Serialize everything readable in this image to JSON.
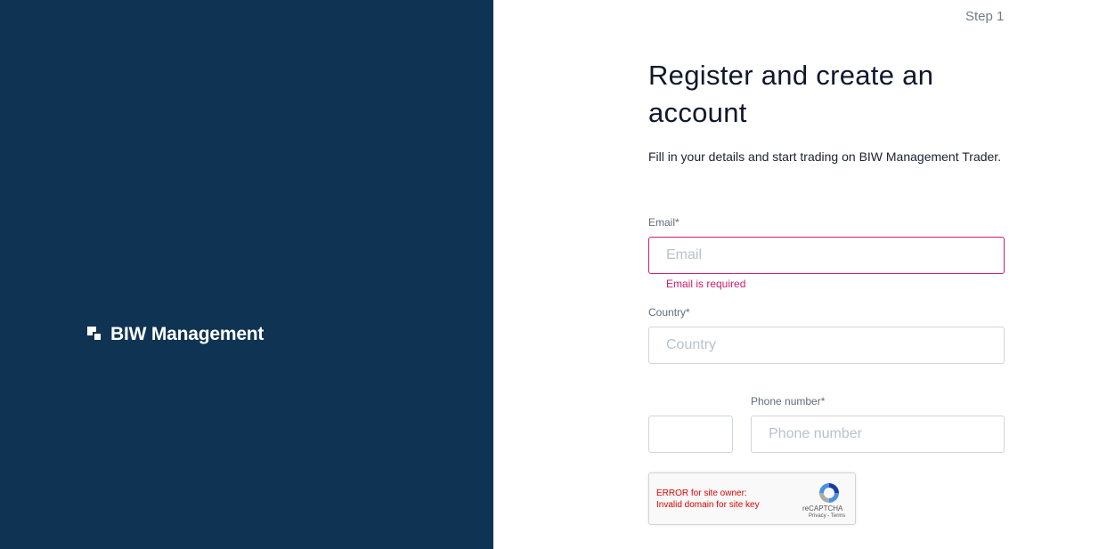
{
  "brand": {
    "name": "BIW Management"
  },
  "header": {
    "step": "Step 1"
  },
  "form": {
    "title": "Register and create an account",
    "subtitle": "Fill in your details and start trading on BIW Management Trader.",
    "email": {
      "label": "Email*",
      "placeholder": "Email",
      "value": "",
      "error": "Email is required"
    },
    "country": {
      "label": "Country*",
      "placeholder": "Country",
      "value": ""
    },
    "phone_code": {
      "value": ""
    },
    "phone": {
      "label": "Phone number*",
      "placeholder": "Phone number",
      "value": ""
    }
  },
  "recaptcha": {
    "error_line1": "ERROR for site owner:",
    "error_line2": "Invalid domain for site key",
    "name": "reCAPTCHA",
    "privacy": "Privacy",
    "terms": "Terms",
    "separator": " - "
  },
  "colors": {
    "left_panel": "#0f3353",
    "error": "#d01a6e",
    "recaptcha_error": "#e00000"
  }
}
